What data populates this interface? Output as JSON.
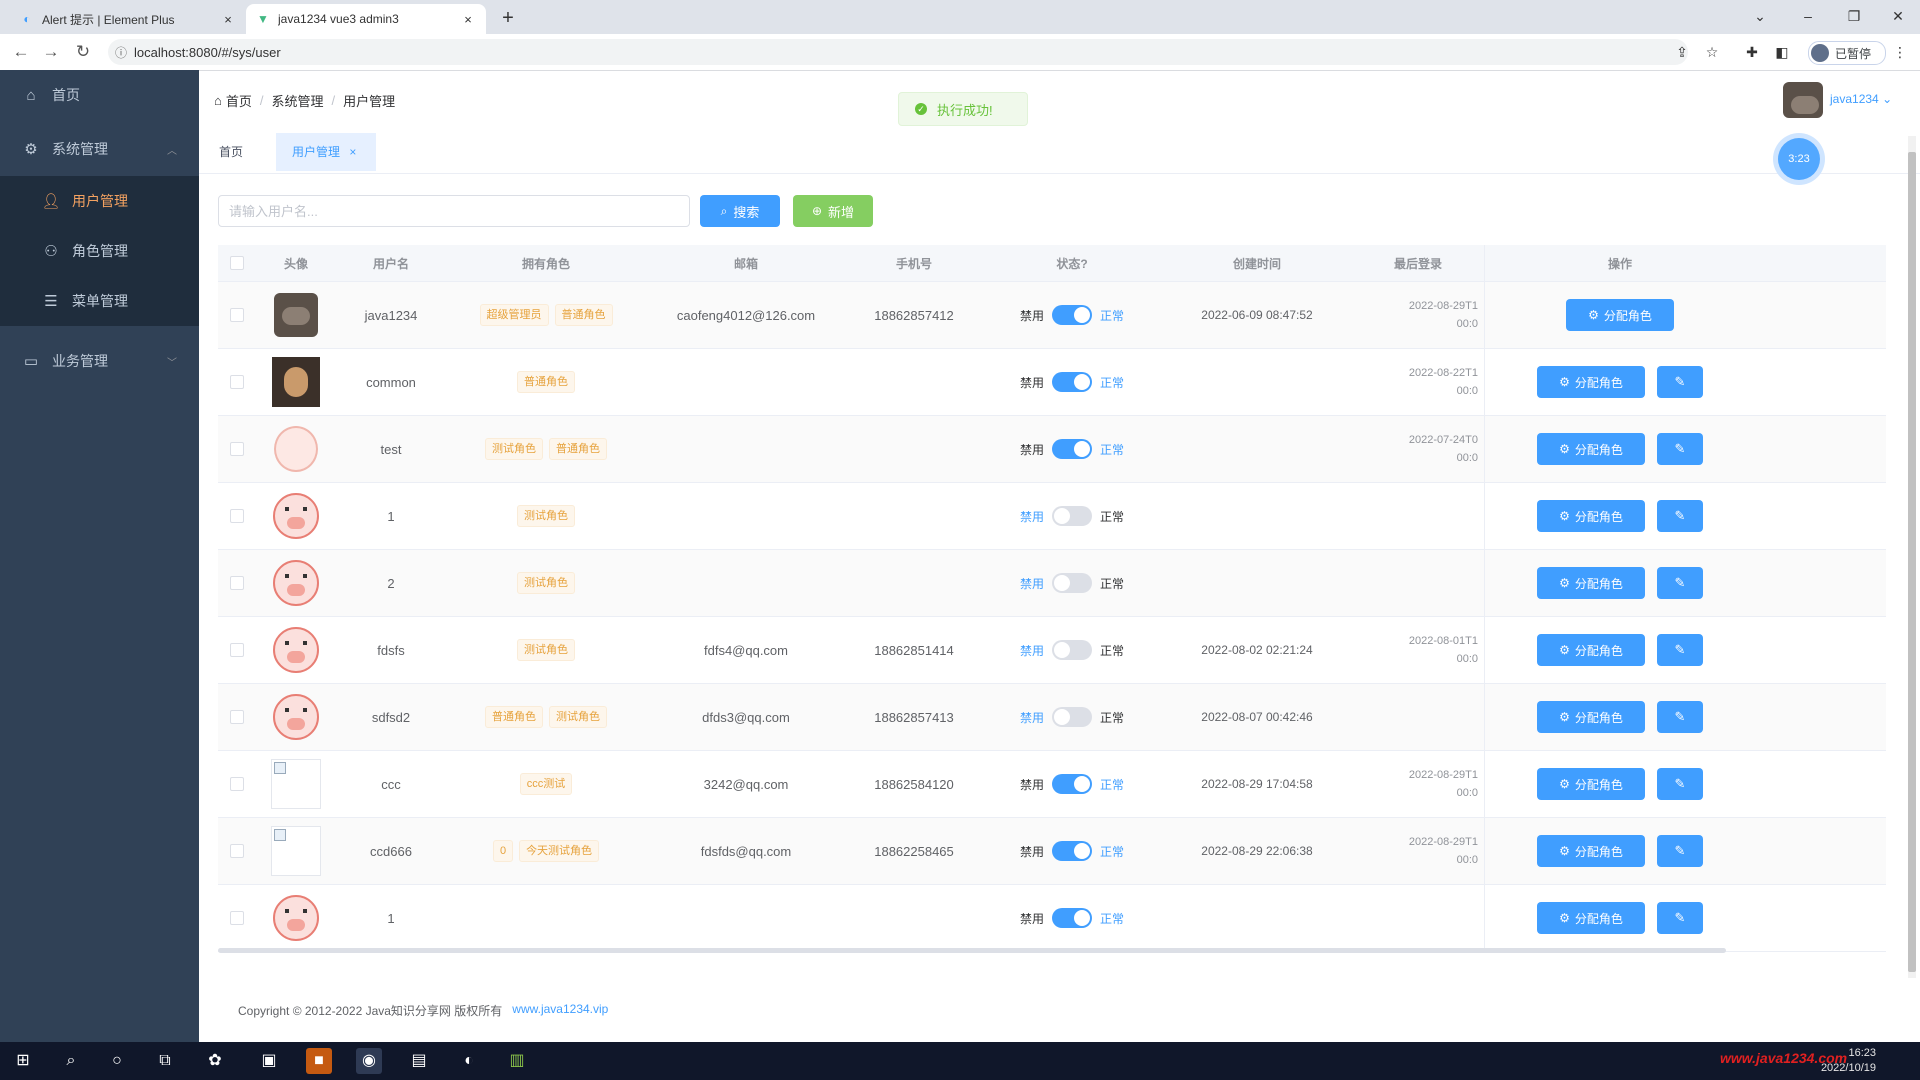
{
  "browser": {
    "tabs": [
      {
        "label": "Alert 提示 | Element Plus",
        "close": "×"
      },
      {
        "label": "java1234 vue3 admin3",
        "close": "×"
      }
    ],
    "new_tab": "+",
    "url": "localhost:8080/#/sys/user",
    "profile_label": "已暂停"
  },
  "sidebar": {
    "items": [
      {
        "label": "首页",
        "icon": "home-icon"
      },
      {
        "label": "系统管理",
        "icon": "gear-icon"
      },
      {
        "label": "用户管理",
        "icon": "user-icon"
      },
      {
        "label": "角色管理",
        "icon": "users-icon"
      },
      {
        "label": "菜单管理",
        "icon": "menu-icon"
      },
      {
        "label": "业务管理",
        "icon": "monitor-icon"
      }
    ]
  },
  "header": {
    "breadcrumb": [
      "首页",
      "系统管理",
      "用户管理"
    ],
    "toast": "执行成功!",
    "username": "java1234"
  },
  "page_tabs": {
    "home": "首页",
    "user": "用户管理",
    "close": "×"
  },
  "fab_label": "3:23",
  "search": {
    "placeholder": "请输入用户名...",
    "search_label": "搜索",
    "add_label": "新增"
  },
  "table": {
    "columns": [
      "",
      "头像",
      "用户名",
      "拥有角色",
      "邮箱",
      "手机号",
      "状态?",
      "创建时间",
      "最后登录",
      "操作"
    ],
    "rows": [
      {
        "avatar": "boar",
        "username": "java1234",
        "roles": [
          "超级管理员",
          "普通角色"
        ],
        "email": "caofeng4012@126.com",
        "phone": "18862857412",
        "disabled": "禁用",
        "enabled": true,
        "normal": "正常",
        "created": "2022-06-09 08:47:52",
        "login1": "2022-08-29T1",
        "login2": "00:0",
        "edit": false
      },
      {
        "avatar": "dark",
        "username": "common",
        "roles": [
          "普通角色"
        ],
        "email": "",
        "phone": "",
        "disabled": "禁用",
        "enabled": true,
        "normal": "正常",
        "created": "",
        "login1": "2022-08-22T1",
        "login2": "00:0",
        "edit": true
      },
      {
        "avatar": "anime",
        "username": "test",
        "roles": [
          "测试角色",
          "普通角色"
        ],
        "email": "",
        "phone": "",
        "disabled": "禁用",
        "enabled": true,
        "normal": "正常",
        "created": "",
        "login1": "2022-07-24T0",
        "login2": "00:0",
        "edit": true
      },
      {
        "avatar": "pig",
        "username": "1",
        "roles": [
          "测试角色"
        ],
        "email": "",
        "phone": "",
        "disabled": "禁用",
        "enabled": false,
        "normal": "正常",
        "created": "",
        "login1": "",
        "login2": "",
        "edit": true
      },
      {
        "avatar": "pig",
        "username": "2",
        "roles": [
          "测试角色"
        ],
        "email": "",
        "phone": "",
        "disabled": "禁用",
        "enabled": false,
        "normal": "正常",
        "created": "",
        "login1": "",
        "login2": "",
        "edit": true
      },
      {
        "avatar": "pig",
        "username": "fdsfs",
        "roles": [
          "测试角色"
        ],
        "email": "fdfs4@qq.com",
        "phone": "18862851414",
        "disabled": "禁用",
        "enabled": false,
        "normal": "正常",
        "created": "2022-08-02 02:21:24",
        "login1": "2022-08-01T1",
        "login2": "00:0",
        "edit": true
      },
      {
        "avatar": "pig",
        "username": "sdfsd2",
        "roles": [
          "普通角色",
          "测试角色"
        ],
        "email": "dfds3@qq.com",
        "phone": "18862857413",
        "disabled": "禁用",
        "enabled": false,
        "normal": "正常",
        "created": "2022-08-07 00:42:46",
        "login1": "",
        "login2": "",
        "edit": true
      },
      {
        "avatar": "broken",
        "username": "ccc",
        "roles": [
          "ccc测试"
        ],
        "email": "3242@qq.com",
        "phone": "18862584120",
        "disabled": "禁用",
        "enabled": true,
        "normal": "正常",
        "created": "2022-08-29 17:04:58",
        "login1": "2022-08-29T1",
        "login2": "00:0",
        "edit": true
      },
      {
        "avatar": "broken",
        "username": "ccd666",
        "roles": [
          "0",
          "今天测试角色"
        ],
        "email": "fdsfds@qq.com",
        "phone": "18862258465",
        "disabled": "禁用",
        "enabled": true,
        "normal": "正常",
        "created": "2022-08-29 22:06:38",
        "login1": "2022-08-29T1",
        "login2": "00:0",
        "edit": true
      },
      {
        "avatar": "pig",
        "username": "1",
        "roles": [],
        "email": "",
        "phone": "",
        "disabled": "禁用",
        "enabled": true,
        "normal": "正常",
        "created": "",
        "login1": "",
        "login2": "",
        "edit": true
      }
    ],
    "assign_label": "分配角色",
    "edit_icon": "edit-icon"
  },
  "footer": {
    "text": "Copyright © 2012-2022 Java知识分享网 版权所有",
    "link": "www.java1234.vip"
  },
  "taskbar": {
    "time": "16:23",
    "date": "2022/10/19",
    "watermark": "www.java1234.com"
  },
  "colors": {
    "primary": "#409eff",
    "success": "#67c23a",
    "sidebar_bg": "#304156",
    "tag_warning": "#e6a23c"
  }
}
